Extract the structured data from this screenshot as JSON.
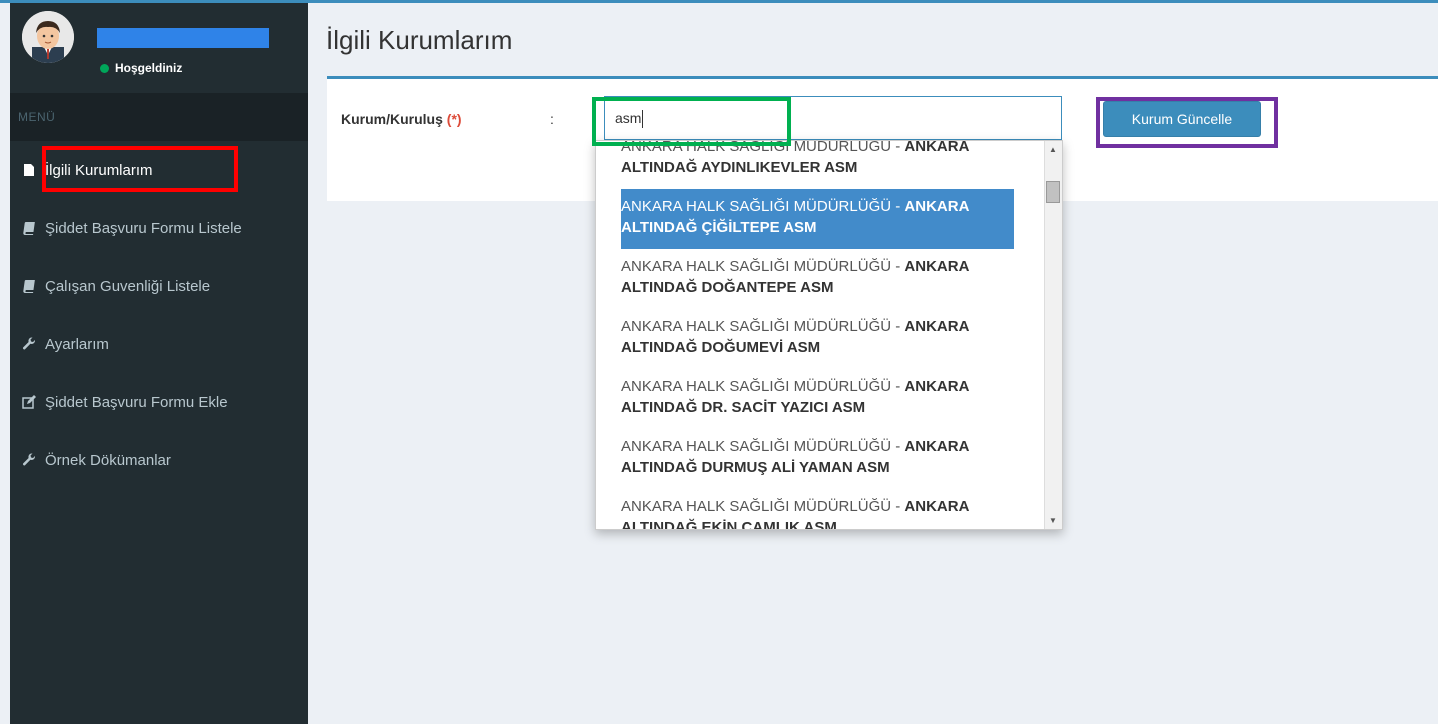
{
  "sidebar": {
    "status": "Hoşgeldiniz",
    "menu_header": "MENÜ",
    "items": [
      {
        "label": "İlgili Kurumlarım",
        "icon": "file-icon"
      },
      {
        "label": "Şiddet Başvuru Formu Listele",
        "icon": "book-icon"
      },
      {
        "label": "Çalışan Guvenliği Listele",
        "icon": "book-icon"
      },
      {
        "label": "Ayarlarım",
        "icon": "wrench-icon"
      },
      {
        "label": "Şiddet Başvuru Formu Ekle",
        "icon": "edit-icon"
      },
      {
        "label": "Örnek Dökümanlar",
        "icon": "wrench-icon"
      }
    ]
  },
  "page": {
    "title": "İlgili Kurumlarım"
  },
  "form": {
    "label": "Kurum/Kuruluş",
    "required_mark": "(*)",
    "colon": ":",
    "input_value": "asm",
    "button_label": "Kurum Güncelle"
  },
  "dropdown": {
    "items": [
      {
        "prefix": "ANKARA HALK SAĞLIĞI MÜDÜRLÜĞÜ - ",
        "bold": "ANKARA ALTINDAĞ AYDINLIKEVLER ASM"
      },
      {
        "prefix": "ANKARA HALK SAĞLIĞI MÜDÜRLÜĞÜ - ",
        "bold": "ANKARA ALTINDAĞ ÇİĞİLTEPE ASM"
      },
      {
        "prefix": "ANKARA HALK SAĞLIĞI MÜDÜRLÜĞÜ - ",
        "bold": "ANKARA ALTINDAĞ DOĞANTEPE ASM"
      },
      {
        "prefix": "ANKARA HALK SAĞLIĞI MÜDÜRLÜĞÜ - ",
        "bold": "ANKARA ALTINDAĞ DOĞUMEVİ ASM"
      },
      {
        "prefix": "ANKARA HALK SAĞLIĞI MÜDÜRLÜĞÜ - ",
        "bold": "ANKARA ALTINDAĞ DR. SACİT YAZICI ASM"
      },
      {
        "prefix": "ANKARA HALK SAĞLIĞI MÜDÜRLÜĞÜ - ",
        "bold": "ANKARA ALTINDAĞ DURMUŞ ALİ YAMAN ASM"
      },
      {
        "prefix": "ANKARA HALK SAĞLIĞI MÜDÜRLÜĞÜ - ",
        "bold": "ANKARA ALTINDAĞ EKİN ÇAMLIK ASM"
      }
    ],
    "highlighted_index": 1
  },
  "colors": {
    "sidebar": "#222d32",
    "accent": "#3c8dbc",
    "highlight_red": "#ff0000",
    "highlight_green": "#00b050",
    "highlight_purple": "#7030a0"
  }
}
